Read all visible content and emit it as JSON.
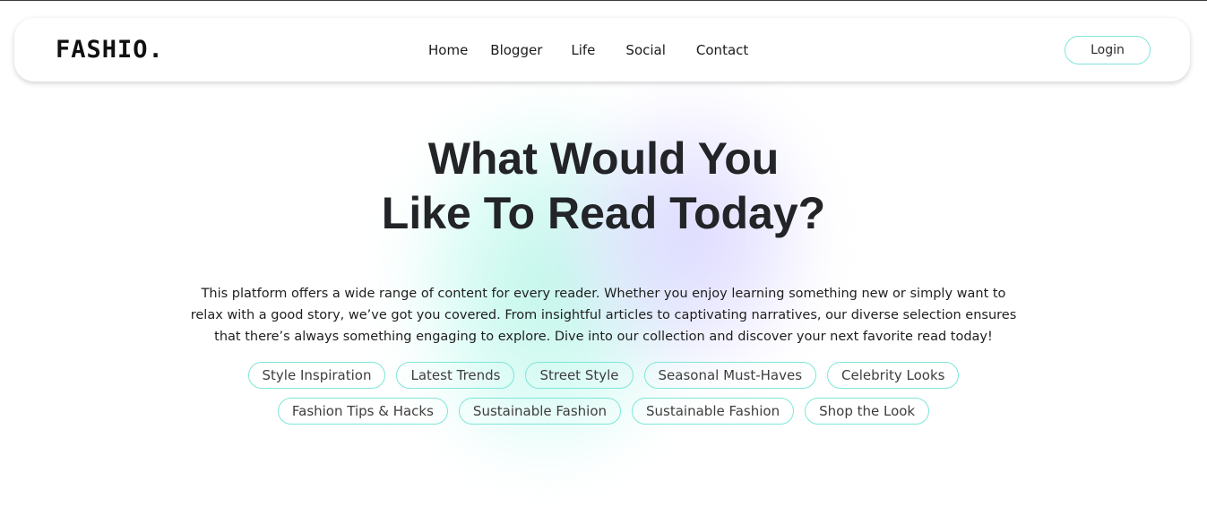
{
  "header": {
    "logo": "FASHIO.",
    "nav": [
      {
        "label": "Home"
      },
      {
        "label": "Blogger"
      },
      {
        "label": "Life"
      },
      {
        "label": "Social"
      },
      {
        "label": "Contact"
      }
    ],
    "login_label": "Login"
  },
  "hero": {
    "title_line_1": "What Would You",
    "title_line_2": "Like To Read Today?",
    "description": "This platform offers a wide range of content for every reader. Whether you enjoy learning something new or simply want to relax with a good story, we’ve got you covered. From insightful articles to captivating narratives, our diverse selection ensures that there’s always something engaging to explore. Dive into our collection and discover your next favorite read today!"
  },
  "tags": {
    "row_1": [
      "Style Inspiration",
      "Latest Trends",
      "Street Style",
      "Seasonal Must-Haves",
      "Celebrity Looks"
    ],
    "row_2": [
      "Fashion Tips & Hacks",
      "Sustainable Fashion",
      "Sustainable Fashion",
      "Shop the Look"
    ]
  },
  "colors": {
    "accent_border": "#7ee6d8",
    "glow_mint": "#c8faf0",
    "glow_lavender": "#e1deff",
    "text_dark": "#222428"
  }
}
